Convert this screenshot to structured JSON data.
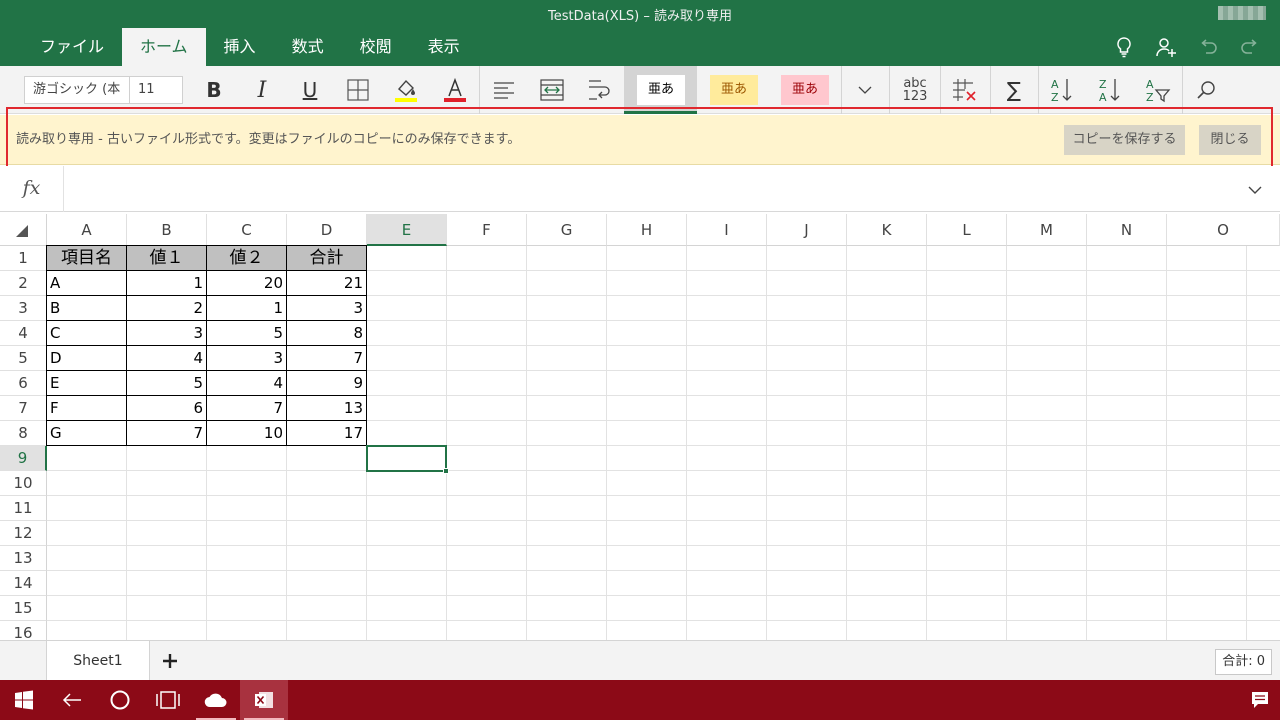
{
  "window": {
    "title": "TestData(XLS) – 読み取り専用"
  },
  "ribbon_tabs": [
    {
      "label": "ファイル",
      "active": false
    },
    {
      "label": "ホーム",
      "active": true
    },
    {
      "label": "挿入",
      "active": false
    },
    {
      "label": "数式",
      "active": false
    },
    {
      "label": "校閲",
      "active": false
    },
    {
      "label": "表示",
      "active": false
    }
  ],
  "title_icons": [
    "tell-me-lightbulb-icon",
    "share-person-icon",
    "undo-icon",
    "redo-icon"
  ],
  "ribbon": {
    "font_name": "游ゴシック (本",
    "font_size": "11",
    "bold": "B",
    "italic": "I",
    "underline": "U",
    "cell_styles": [
      {
        "label": "亜あ",
        "bg": "#ffffff",
        "color": "#000000"
      },
      {
        "label": "亜あ",
        "bg": "#ffeb9c",
        "color": "#9c5700"
      },
      {
        "label": "亜あ",
        "bg": "#ffc7ce",
        "color": "#9c0006"
      }
    ],
    "number_format": {
      "top": "abc",
      "bottom": "123"
    },
    "sum_symbol": "∑"
  },
  "notice": {
    "text": "読み取り専用 - 古いファイル形式です。変更はファイルのコピーにのみ保存できます。",
    "save_copy_label": "コピーを保存する",
    "close_label": "閉じる"
  },
  "formula_bar": {
    "fx_label": "fx",
    "value": ""
  },
  "grid": {
    "columns": [
      "A",
      "B",
      "C",
      "D",
      "E",
      "F",
      "G",
      "H",
      "I",
      "J",
      "K",
      "L",
      "M",
      "N",
      "O"
    ],
    "selected_column": "E",
    "rows": [
      "1",
      "2",
      "3",
      "4",
      "5",
      "6",
      "7",
      "8",
      "9",
      "10",
      "11",
      "12",
      "13",
      "14",
      "15",
      "16"
    ],
    "selected_row": "9",
    "selected_cell": "E9",
    "header_row": [
      "項目名",
      "値１",
      "値２",
      "合計"
    ],
    "data_rows": [
      [
        "A",
        "1",
        "20",
        "21"
      ],
      [
        "B",
        "2",
        "1",
        "3"
      ],
      [
        "C",
        "3",
        "5",
        "8"
      ],
      [
        "D",
        "4",
        "3",
        "7"
      ],
      [
        "E",
        "5",
        "4",
        "9"
      ],
      [
        "F",
        "6",
        "7",
        "13"
      ],
      [
        "G",
        "7",
        "10",
        "17"
      ]
    ]
  },
  "sheets": {
    "tabs": [
      "Sheet1"
    ],
    "status": "合計: 0"
  },
  "taskbar": {
    "items": [
      "windows-start-icon",
      "back-arrow-icon",
      "cortana-circle-icon",
      "task-view-icon",
      "onedrive-cloud-icon",
      "excel-app-icon",
      "action-center-icon"
    ]
  },
  "colors": {
    "excel_green": "#217346",
    "taskbar": "#8c0a17",
    "notice_bg": "#fff4ce",
    "highlight_border": "#e0282e",
    "table_header_bg": "#c0c0c0"
  }
}
